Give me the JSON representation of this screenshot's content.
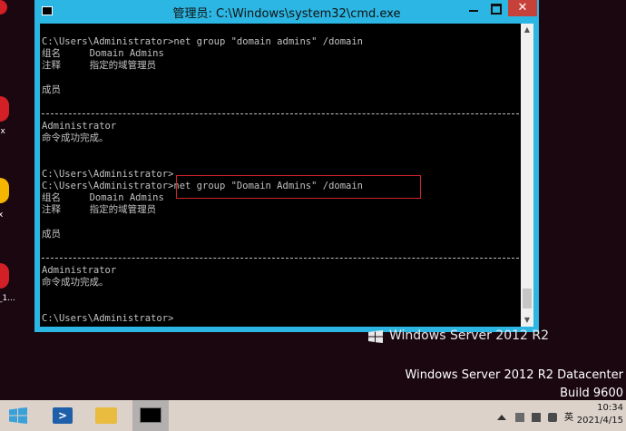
{
  "desktop": {
    "icons": [
      {
        "label": "",
        "color": "#d31f26"
      },
      {
        "label": "ix",
        "color": "#d31f26"
      },
      {
        "label": "x",
        "color": "#f5b600"
      },
      {
        "label": "_1...",
        "color": "#d31f26"
      }
    ]
  },
  "window": {
    "title": "管理员: C:\\Windows\\system32\\cmd.exe",
    "close_glyph": "✕",
    "colors": {
      "frame": "#2cb6e3",
      "close": "#c7413b",
      "console_bg": "#000000",
      "console_fg": "#c0c0c0",
      "highlight": "#d2232a"
    }
  },
  "console": {
    "lines": [
      "C:\\Users\\Administrator>net group \"domain admins\" /domain",
      "组名     Domain Admins",
      "注释     指定的域管理员",
      "",
      "成员",
      "",
      "",
      "Administrator",
      "命令成功完成。",
      "",
      "",
      "C:\\Users\\Administrator>",
      "C:\\Users\\Administrator>net group \"Domain Admins\" /domain",
      "组名     Domain Admins",
      "注释     指定的域管理员",
      "",
      "成员",
      "",
      "",
      "Administrator",
      "命令成功完成。",
      "",
      "",
      "C:\\Users\\Administrator>"
    ]
  },
  "watermark": {
    "logo_text": "Windows Server 2012 R2",
    "edition": "Windows Server 2012 R2 Datacenter",
    "build": "Build 9600"
  },
  "taskbar": {
    "items": [
      "start-icon",
      "powershell-icon",
      "file-explorer-icon",
      "cmd-icon"
    ],
    "tray_ime": "英",
    "time": "10:34",
    "date": "2021/4/15"
  }
}
